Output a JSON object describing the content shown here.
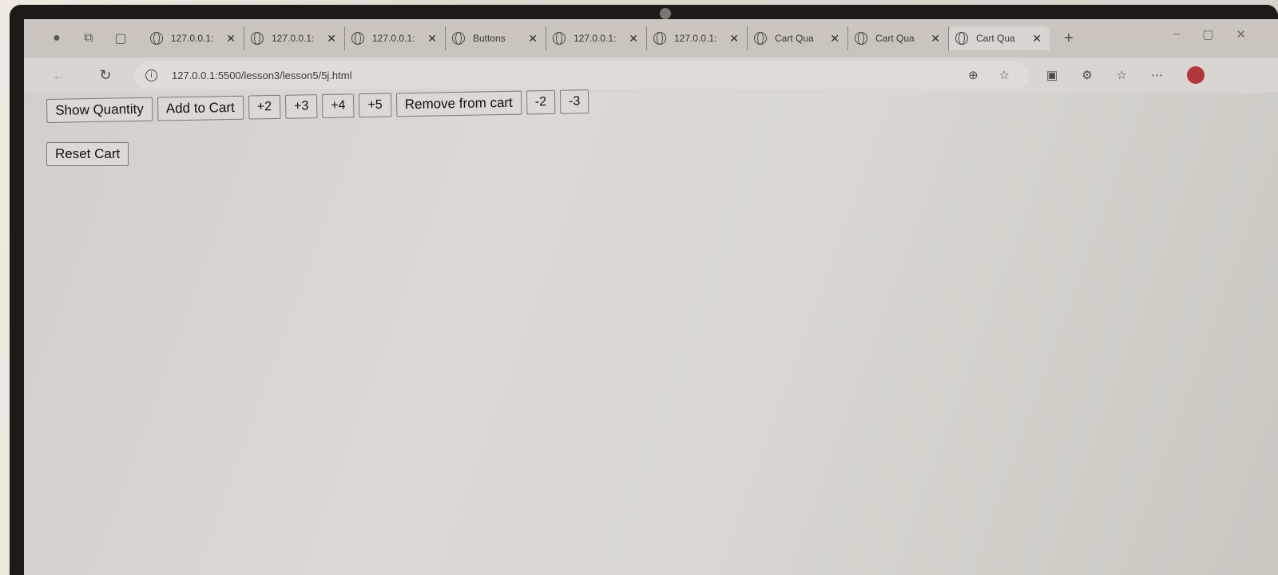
{
  "browser": {
    "tabs": [
      {
        "title": "127.0.0.1:",
        "active": false
      },
      {
        "title": "127.0.0.1:",
        "active": false
      },
      {
        "title": "127.0.0.1:",
        "active": false
      },
      {
        "title": "Buttons",
        "active": false
      },
      {
        "title": "127.0.0.1:",
        "active": false
      },
      {
        "title": "127.0.0.1:",
        "active": false
      },
      {
        "title": "Cart Qua",
        "active": false
      },
      {
        "title": "Cart Qua",
        "active": false
      },
      {
        "title": "Cart Qua",
        "active": true
      }
    ],
    "url": "127.0.0.1:5500/lesson3/lesson5/5j.html"
  },
  "page": {
    "buttons": {
      "show_quantity": "Show Quantity",
      "add_to_cart": "Add to Cart",
      "plus2": "+2",
      "plus3": "+3",
      "plus4": "+4",
      "plus5": "+5",
      "remove_from_cart": "Remove from cart",
      "minus2": "-2",
      "minus3": "-3",
      "reset_cart": "Reset Cart"
    }
  }
}
